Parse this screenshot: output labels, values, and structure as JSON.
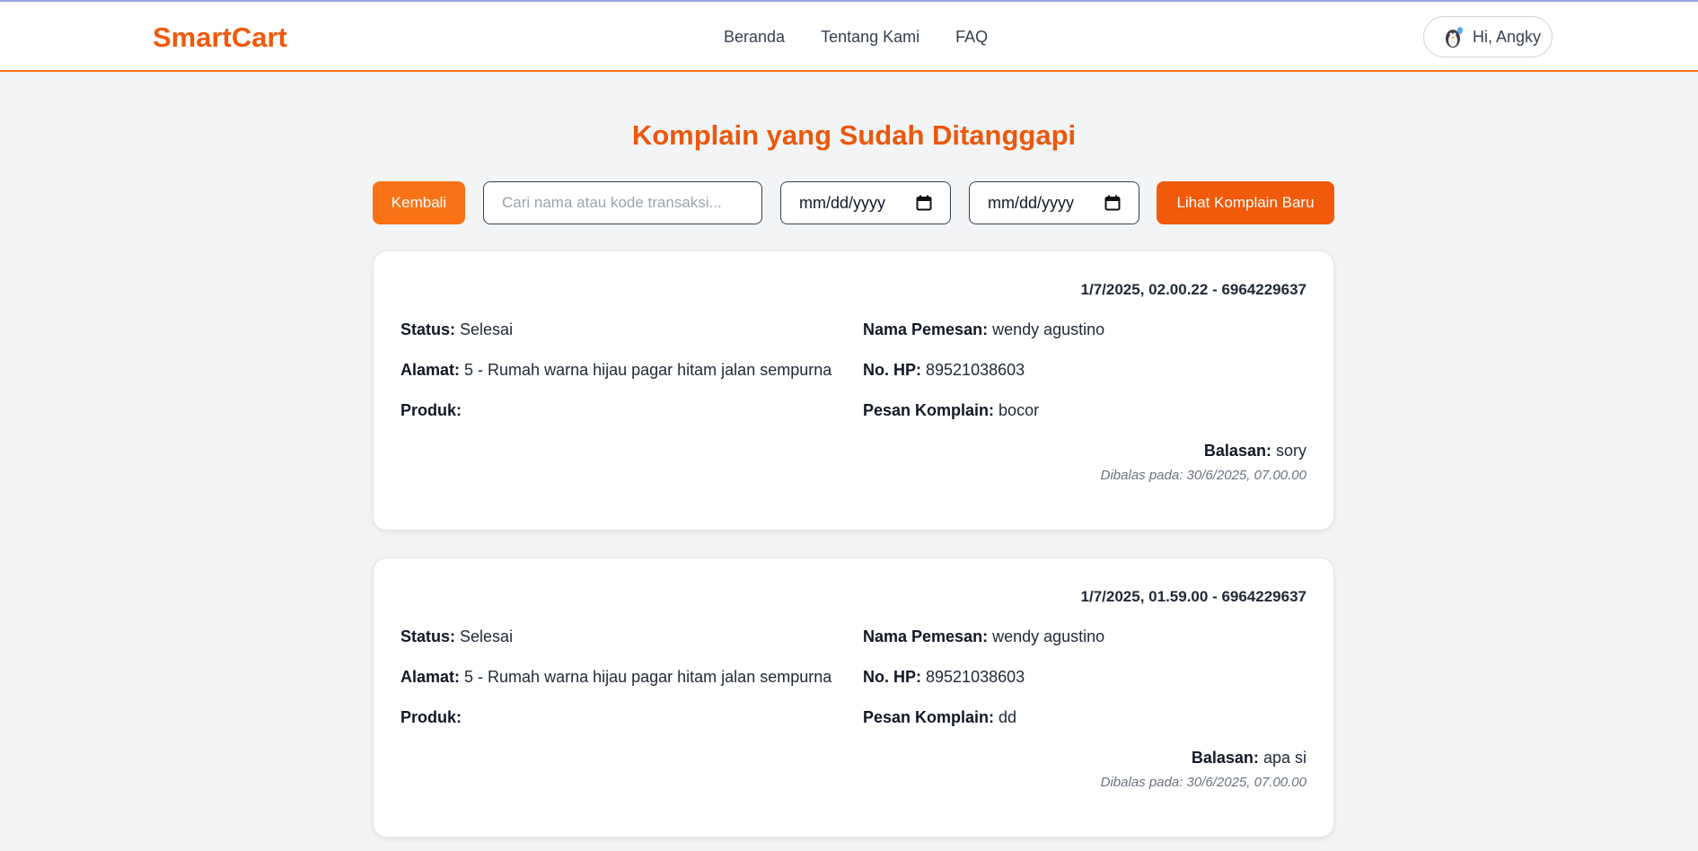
{
  "header": {
    "brand": "SmartCart",
    "nav": [
      "Beranda",
      "Tentang Kami",
      "FAQ"
    ],
    "user_greeting": "Hi, Angky"
  },
  "page_title": "Komplain yang Sudah Ditanggapi",
  "toolbar": {
    "back_label": "Kembali",
    "search_placeholder": "Cari nama atau kode transaksi...",
    "search_value": "",
    "date_from": "mm/dd/yyyy",
    "date_to": "mm/dd/yyyy",
    "new_complaints_label": "Lihat Komplain Baru"
  },
  "labels": {
    "status": "Status:",
    "address": "Alamat:",
    "product": "Produk:",
    "customer": "Nama Pemesan:",
    "phone": "No. HP:",
    "message": "Pesan Komplain:",
    "reply": "Balasan:"
  },
  "complaints": [
    {
      "datetime_code": "1/7/2025, 02.00.22 - 6964229637",
      "status": "Selesai",
      "address": "5 - Rumah warna hijau pagar hitam jalan sempurna",
      "product": "",
      "customer": "wendy agustino",
      "phone": "89521038603",
      "message": "bocor",
      "reply": "sory",
      "replied_at": "Dibalas pada: 30/6/2025, 07.00.00"
    },
    {
      "datetime_code": "1/7/2025, 01.59.00 - 6964229637",
      "status": "Selesai",
      "address": "5 - Rumah warna hijau pagar hitam jalan sempurna",
      "product": "",
      "customer": "wendy agustino",
      "phone": "89521038603",
      "message": "dd",
      "reply": "apa si",
      "replied_at": "Dibalas pada: 30/6/2025, 07.00.00"
    }
  ],
  "colors": {
    "brand": "#f05a0a",
    "accent": "#f97316",
    "background": "#f3f4f6"
  }
}
